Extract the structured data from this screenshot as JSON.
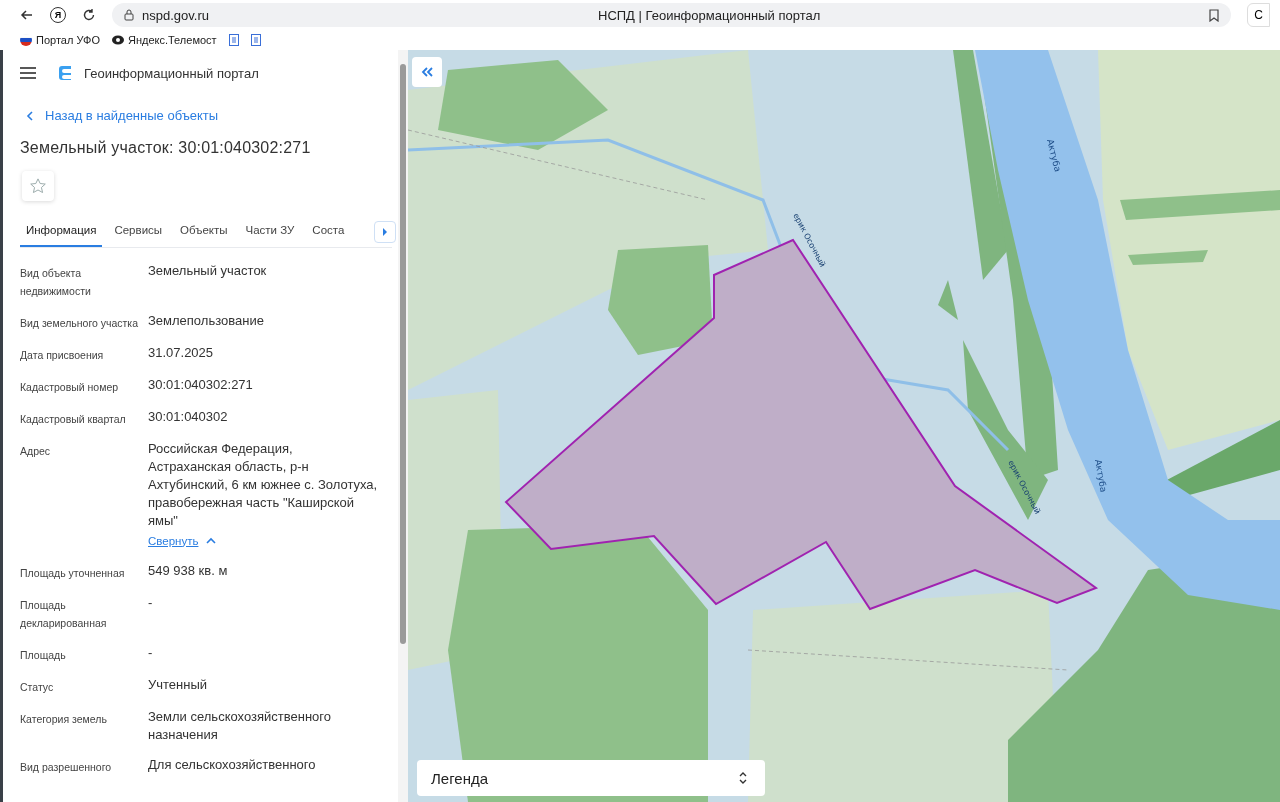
{
  "browser": {
    "logo_letter": "Я",
    "url": "nspd.gov.ru",
    "title": "НСПД | Геоинформационный портал",
    "side_button": "С"
  },
  "bookmarks": [
    {
      "kind": "flag",
      "label": "Портал УФО"
    },
    {
      "kind": "camera",
      "label": "Яндекс.Телемост"
    },
    {
      "kind": "doc"
    },
    {
      "kind": "doc"
    }
  ],
  "app": {
    "title": "Геоинформационный портал",
    "back_link": "Назад в найденные объекты",
    "heading": "Земельный участок: 30:01:040302:271",
    "favorite": false
  },
  "tabs": [
    {
      "label": "Информация",
      "selected": true
    },
    {
      "label": "Сервисы",
      "selected": false
    },
    {
      "label": "Объекты",
      "selected": false
    },
    {
      "label": "Части ЗУ",
      "selected": false
    },
    {
      "label": "Соста",
      "selected": false
    }
  ],
  "fields": [
    {
      "label": "Вид объекта недвижимости",
      "value": "Земельный участок"
    },
    {
      "label": "Вид земельного участка",
      "value": "Землепользование"
    },
    {
      "label": "Дата присвоения",
      "value": "31.07.2025"
    },
    {
      "label": "Кадастровый номер",
      "value": "30:01:040302:271"
    },
    {
      "label": "Кадастровый квартал",
      "value": "30:01:040302"
    },
    {
      "label": "Адрес",
      "value": "Российская Федерация, Астраханская область, р-н Ахтубинский, 6 км южнее с. Золотуха, правобережная часть \"Каширской ямы\"",
      "toggle": "Свернуть",
      "expanded": true
    },
    {
      "label": "Площадь уточненная",
      "value": "549 938 кв. м"
    },
    {
      "label": "Площадь декларированная",
      "value": "-"
    },
    {
      "label": "Площадь",
      "value": "-"
    },
    {
      "label": "Статус",
      "value": "Учтенный"
    },
    {
      "label": "Категория земель",
      "value": "Земли сельскохозяйственного назначения"
    },
    {
      "label": "Вид разрешенного",
      "value": "Для сельскохозяйственного"
    }
  ],
  "map": {
    "labels": [
      {
        "kind": "river",
        "text": "Актуба"
      },
      {
        "kind": "river",
        "text": "Актуба"
      },
      {
        "kind": "stream",
        "text": "ерик Осочный"
      },
      {
        "kind": "stream",
        "text": "ерик Осочный"
      }
    ],
    "legend": "Легенда"
  }
}
